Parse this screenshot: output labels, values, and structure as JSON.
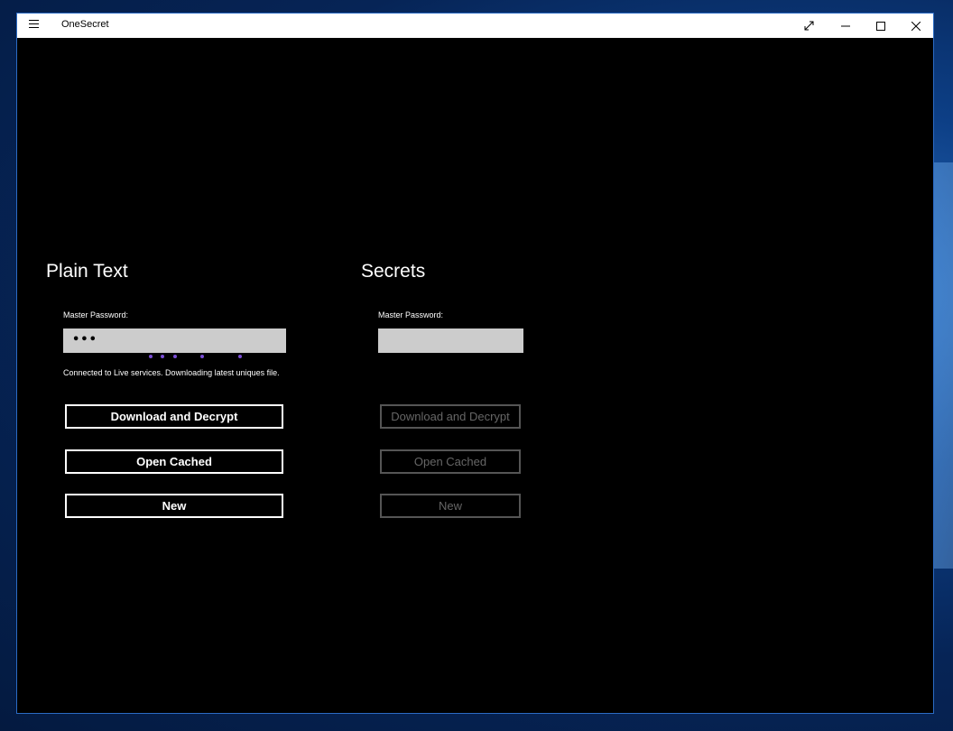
{
  "window": {
    "title": "OneSecret"
  },
  "plain_text": {
    "heading": "Plain Text",
    "password_label": "Master Password:",
    "password_value": "•••",
    "status": "Connected to Live services. Downloading latest uniques file.",
    "progress_color": "#7a4ed6",
    "buttons": {
      "download": "Download and Decrypt",
      "open_cached": "Open Cached",
      "new": "New"
    }
  },
  "secrets": {
    "heading": "Secrets",
    "password_label": "Master Password:",
    "password_value": "",
    "buttons": {
      "download": "Download and Decrypt",
      "open_cached": "Open Cached",
      "new": "New"
    }
  },
  "icons": {
    "menu": "hamburger-icon",
    "expand": "expand-icon",
    "minimize": "minimize-icon",
    "maximize": "maximize-icon",
    "close": "close-icon"
  }
}
